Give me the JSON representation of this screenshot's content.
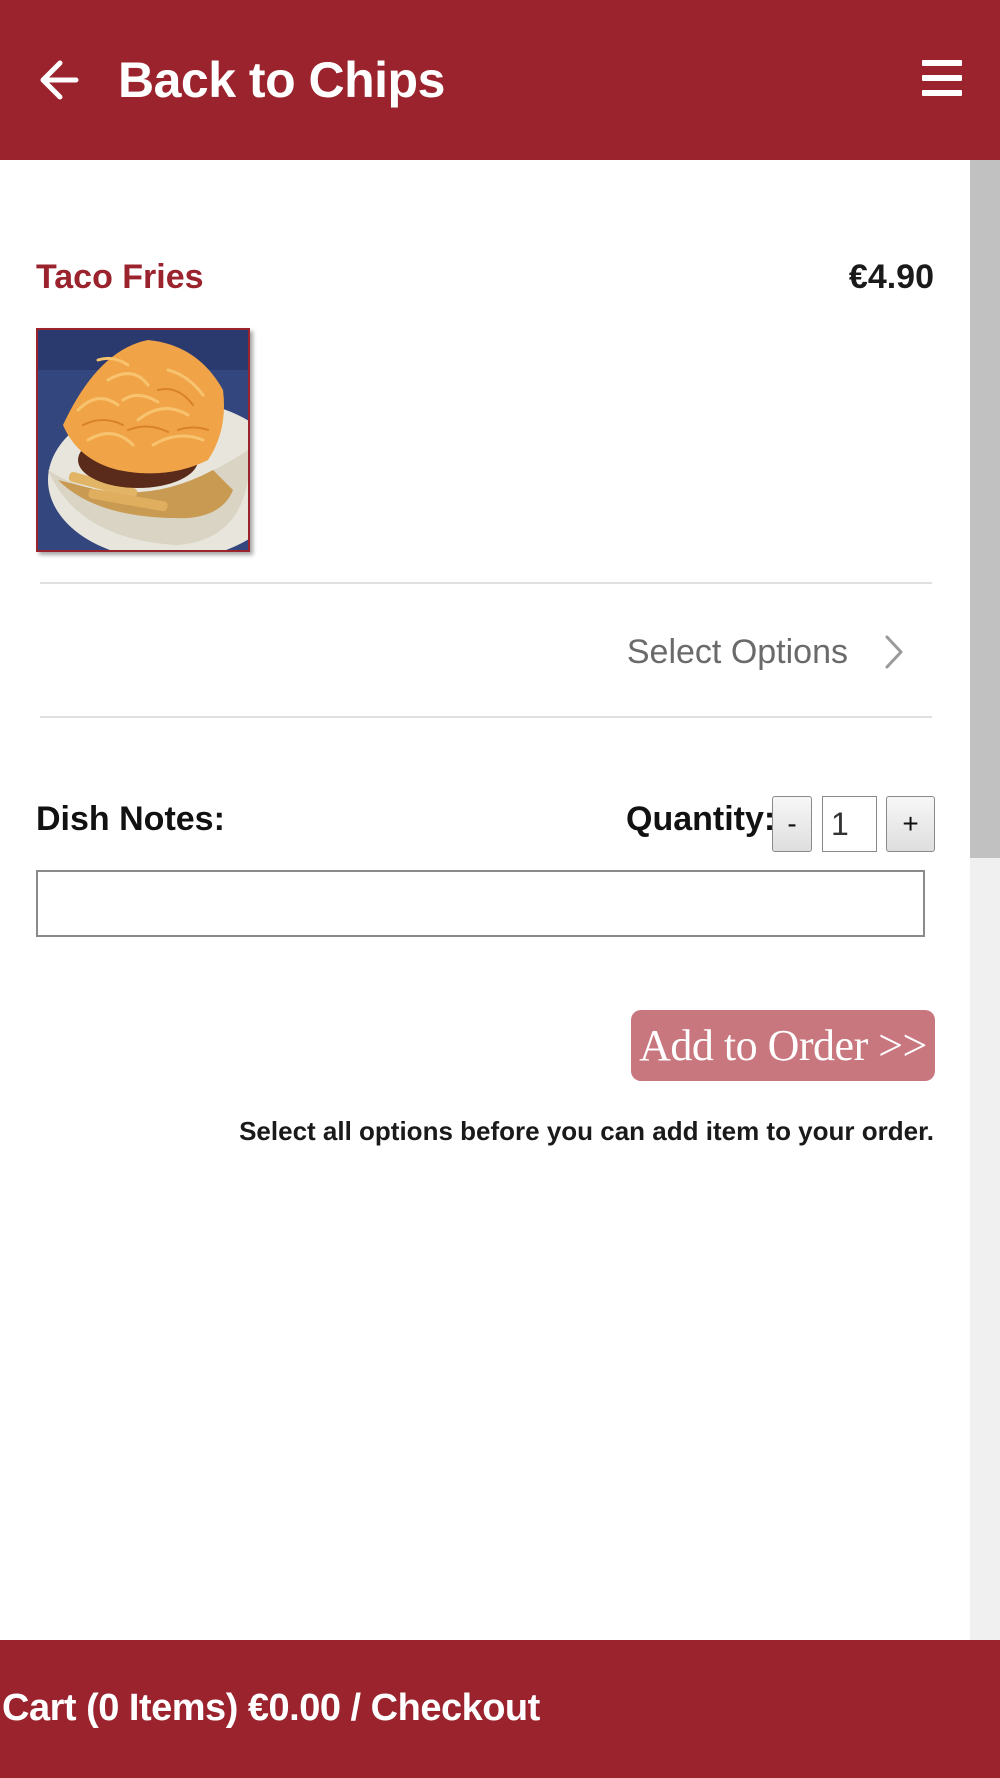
{
  "header": {
    "back_label": "Back to Chips",
    "back_icon": "arrow-left-icon",
    "menu_icon": "hamburger-menu-icon"
  },
  "item": {
    "name": "Taco Fries",
    "price": "€4.90",
    "image_icon": "taco-fries-photo"
  },
  "options": {
    "select_label": "Select Options",
    "icon": "chevron-right-icon"
  },
  "form": {
    "dish_notes_label": "Dish Notes:",
    "dish_notes_value": "",
    "quantity_label": "Quantity:",
    "quantity_value": "1",
    "minus_label": "-",
    "plus_label": "+"
  },
  "actions": {
    "add_to_order_label": "Add to Order >>",
    "hint": "Select all options before you can add item to your order."
  },
  "footer": {
    "cart_label": "Cart (0 Items) €0.00 / Checkout"
  },
  "colors": {
    "brand": "#9b232d",
    "button_disabled": "#c9777f"
  }
}
